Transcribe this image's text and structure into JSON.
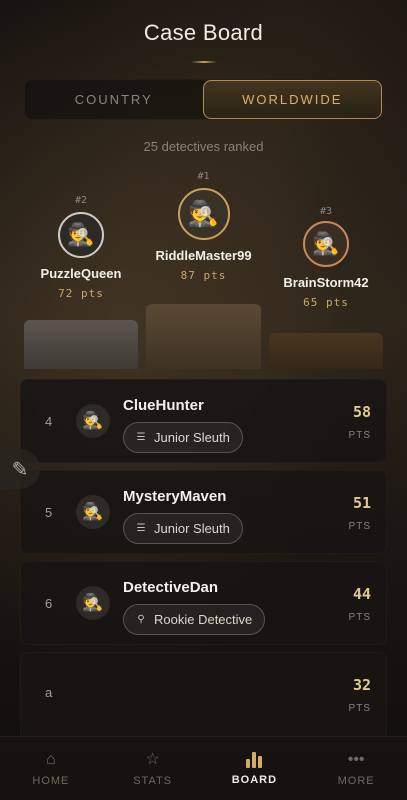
{
  "header": {
    "title": "Case Board"
  },
  "tabs": [
    {
      "label": "COUNTRY",
      "active": false
    },
    {
      "label": "WORLDWIDE",
      "active": true
    }
  ],
  "ranked_count": "25 detectives ranked",
  "podium": {
    "first": {
      "rank": "#1",
      "name": "RiddleMaster99",
      "points": "87 pts",
      "avatar": "🕵️"
    },
    "second": {
      "rank": "#2",
      "name": "PuzzleQueen",
      "points": "72 pts",
      "avatar": "🕵️"
    },
    "third": {
      "rank": "#3",
      "name": "BrainStorm42",
      "points": "65 pts",
      "avatar": "🕵️"
    }
  },
  "list": [
    {
      "rank": "4",
      "name": "ClueHunter",
      "badge": "Junior Sleuth",
      "badge_icon": "magnifier-list-icon",
      "score": "58",
      "unit": "PTS"
    },
    {
      "rank": "5",
      "name": "MysteryMaven",
      "badge": "Junior Sleuth",
      "badge_icon": "magnifier-list-icon",
      "score": "51",
      "unit": "PTS"
    },
    {
      "rank": "6",
      "name": "DetectiveDan",
      "badge": "Rookie Detective",
      "badge_icon": "magnifier-icon",
      "score": "44",
      "unit": "PTS"
    },
    {
      "rank": "a",
      "name": "",
      "badge": "",
      "badge_icon": "",
      "score": "32",
      "unit": "PTS"
    }
  ],
  "nav": [
    {
      "label": "HOME",
      "icon": "home-icon",
      "active": false
    },
    {
      "label": "STATS",
      "icon": "star-icon",
      "active": false
    },
    {
      "label": "BOARD",
      "icon": "chart-icon",
      "active": true
    },
    {
      "label": "MORE",
      "icon": "dots-icon",
      "active": false
    }
  ],
  "colors": {
    "accent": "#d4aa63",
    "background": "#1c1712",
    "gold": "#c9a05c",
    "silver": "#cfcac2",
    "bronze": "#c58b5a"
  }
}
